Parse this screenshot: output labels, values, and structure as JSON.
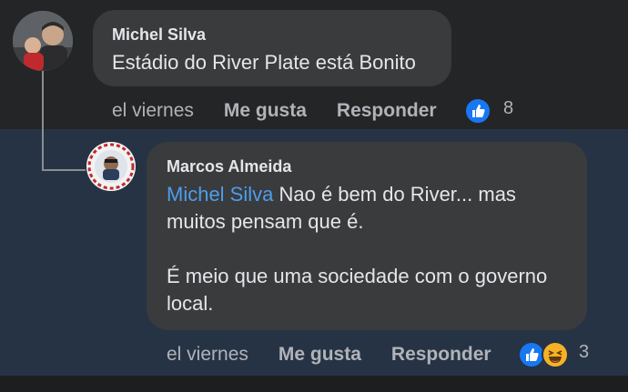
{
  "comment": {
    "author": "Michel Silva",
    "text": "Estádio do River Plate está Bonito",
    "time": "el viernes",
    "like_label": "Me gusta",
    "reply_label": "Responder",
    "reaction_count": "8"
  },
  "reply": {
    "author": "Marcos Almeida",
    "mention": "Michel Silva",
    "text": " Nao é bem do River... mas\nmuitos pensam que é.\n\nÉ meio que uma sociedade com o governo\nlocal.",
    "time": "el viernes",
    "like_label": "Me gusta",
    "reply_label": "Responder",
    "reaction_count": "3"
  },
  "colors": {
    "like": "#1877f2",
    "haha": "#f7b125",
    "mention": "#4c9eed"
  },
  "icons": [
    "like-reaction-icon",
    "haha-reaction-icon"
  ]
}
